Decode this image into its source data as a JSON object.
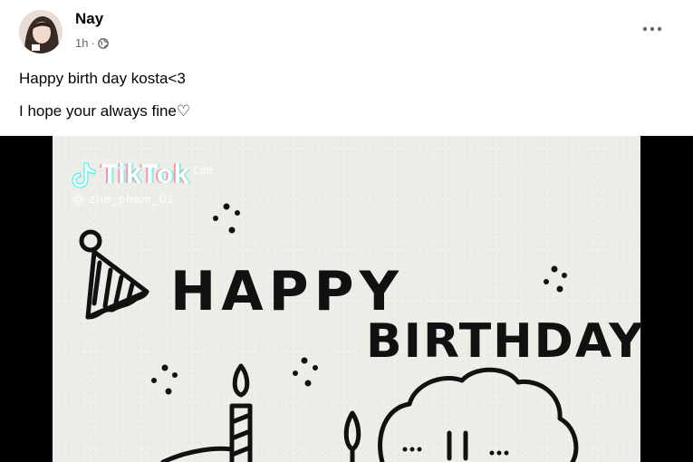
{
  "post": {
    "author": "Nay",
    "time": "1h",
    "privacy_icon": "globe-icon",
    "more_icon": "more-horizontal-icon",
    "text_lines": [
      "Happy birth day kosta<3",
      "I hope your always fine♡"
    ]
  },
  "video": {
    "watermark": {
      "brand": "TikTok",
      "variant": "Lite",
      "handle": "@ zhe_pham_01"
    },
    "drawing_text": [
      "HAPPY",
      "BIRTHDAY"
    ]
  }
}
